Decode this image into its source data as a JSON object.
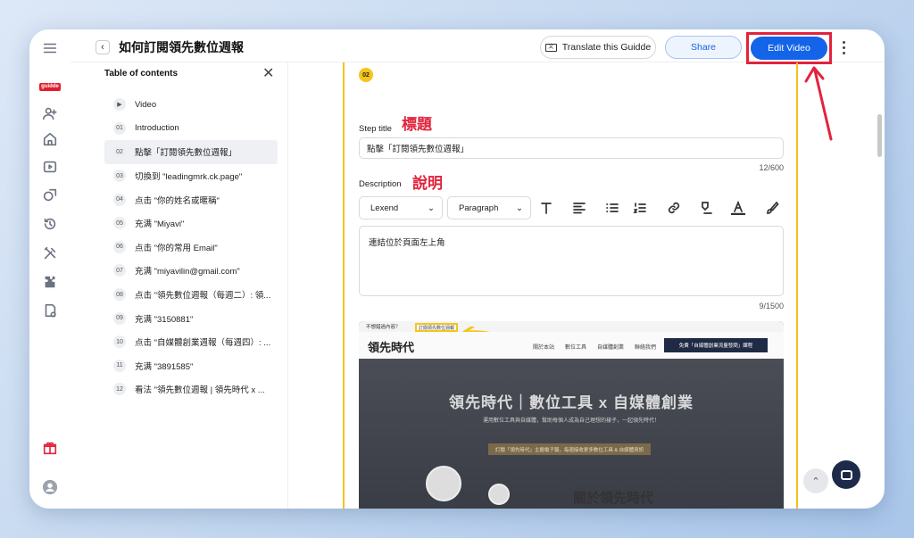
{
  "app": {
    "logo_text": "guidde",
    "page_title": "如何訂閱領先數位週報"
  },
  "header": {
    "translate_label": "Translate this Guidde",
    "share_label": "Share",
    "edit_label": "Edit Video"
  },
  "toc": {
    "title": "Table of contents",
    "items": [
      {
        "num": "",
        "label": "Video",
        "icon": "play-icon"
      },
      {
        "num": "01",
        "label": "Introduction"
      },
      {
        "num": "02",
        "label": "點擊「訂閱領先數位週報」",
        "active": true
      },
      {
        "num": "03",
        "label": "切換到 \"leadingmrk.ck.page\""
      },
      {
        "num": "04",
        "label": "点击 \"你的姓名或暱稱\""
      },
      {
        "num": "05",
        "label": "充满 \"Miyavi\""
      },
      {
        "num": "06",
        "label": "点击 \"你的常用 Email\""
      },
      {
        "num": "07",
        "label": "充满 \"miyavilin@gmail.com\""
      },
      {
        "num": "08",
        "label": "点击 \"領先數位週報（每週二）: 領..."
      },
      {
        "num": "09",
        "label": "充满 \"3150881\""
      },
      {
        "num": "10",
        "label": "点击 \"自媒體創業週報（每週四）: ..."
      },
      {
        "num": "11",
        "label": "充满 \"3891585\""
      },
      {
        "num": "12",
        "label": "看法 \"領先數位週報 | 領先時代 x ..."
      }
    ]
  },
  "editor": {
    "step_number": "02",
    "step_title_label": "Step title",
    "step_title_annotation": "標題",
    "step_title_value": "點擊「訂閱領先數位週報」",
    "step_title_counter": "12/600",
    "description_label": "Description",
    "description_annotation": "說明",
    "font_select": "Lexend",
    "style_select": "Paragraph",
    "description_value": "連結位於頁面左上角",
    "description_counter": "9/1500"
  },
  "screenshot": {
    "top_bar_text": "不想錯過內容？",
    "highlight_text": "訂閱領先數位週報",
    "logo_text": "領先時代",
    "nav_items": [
      "關於本站",
      "數位工具",
      "自媒體創業",
      "聯絡我們"
    ],
    "cta_text": "免費「自媒體創業流量發問」課程",
    "hero_title": "領先時代｜數位工具 x 自媒體創業",
    "hero_subtitle": "運用數位工具與自媒體，幫助每個人成為自己理想的樣子，一起領先時代！",
    "hero_pill": "訂閱「領先時代」主題電子報，每週接收更多數位工具 & 自媒體資訊",
    "bottom_title": "關於領先時代"
  },
  "colors": {
    "primary": "#1364e8",
    "highlight_red": "#e2233d",
    "step_yellow": "#f5c518"
  }
}
